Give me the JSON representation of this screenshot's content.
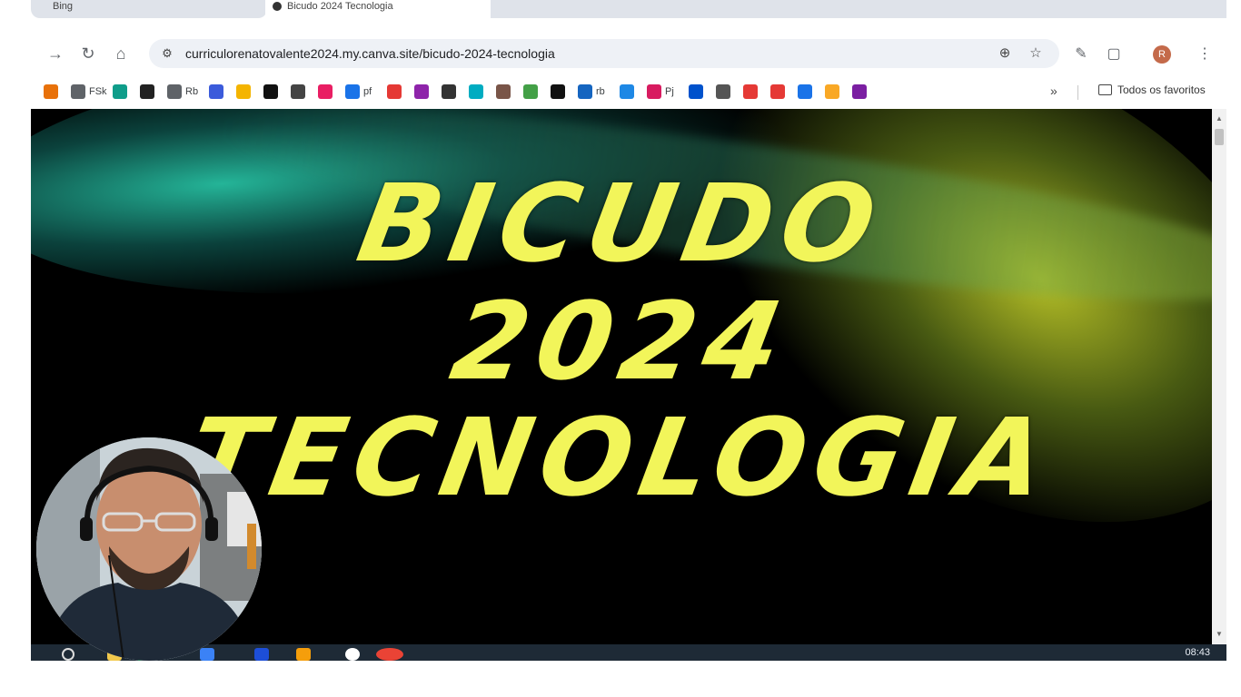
{
  "browser": {
    "tabs": [
      {
        "label": "Bing"
      },
      {
        "label": "Bicudo 2024 Tecnologia"
      }
    ],
    "url": "curriculorenatovalente2024.my.canva.site/bicudo-2024-tecnologia",
    "bookmarks": [
      {
        "label": "",
        "icon": "warning-triangle-icon",
        "color": "#e8710a"
      },
      {
        "label": "FSk",
        "icon": "globe-icon",
        "color": "#5f6368"
      },
      {
        "label": "",
        "icon": "globe-teal-icon",
        "color": "#0f9d8a"
      },
      {
        "label": "",
        "icon": "wikipedia-icon",
        "color": "#222222"
      },
      {
        "label": "Rb",
        "icon": "globe-icon",
        "color": "#5f6368"
      },
      {
        "label": "",
        "icon": "u-icon",
        "color": "#3b5bdb"
      },
      {
        "label": "",
        "icon": "yellow-square-icon",
        "color": "#f4b400"
      },
      {
        "label": "",
        "icon": "black-square-icon",
        "color": "#111111"
      },
      {
        "label": "",
        "icon": "grid-icon",
        "color": "#444444"
      },
      {
        "label": "",
        "icon": "colorful-square-icon",
        "color": "#e91e63"
      },
      {
        "label": "pf",
        "icon": "droplet-icon",
        "color": "#1a73e8"
      },
      {
        "label": "",
        "icon": "chart-icon",
        "color": "#e53935"
      },
      {
        "label": "",
        "icon": "circle-icon",
        "color": "#8e24aa"
      },
      {
        "label": "",
        "icon": "link-icon",
        "color": "#333333"
      },
      {
        "label": "",
        "icon": "q-icon",
        "color": "#00acc1"
      },
      {
        "label": "",
        "icon": "person-icon",
        "color": "#795548"
      },
      {
        "label": "",
        "icon": "palette-icon",
        "color": "#43a047"
      },
      {
        "label": "",
        "icon": "u-black-icon",
        "color": "#111111"
      },
      {
        "label": "rb",
        "icon": "r-icon",
        "color": "#1565c0"
      },
      {
        "label": "",
        "icon": "c-icon",
        "color": "#1e88e5"
      },
      {
        "label": "Pj",
        "icon": "stack-icon",
        "color": "#d81b60"
      },
      {
        "label": "",
        "icon": "trello-icon",
        "color": "#0052cc"
      },
      {
        "label": "",
        "icon": "openai-icon",
        "color": "#555555"
      },
      {
        "label": "",
        "icon": "y-icon",
        "color": "#e53935"
      },
      {
        "label": "",
        "icon": "grad-cap-icon",
        "color": "#e53935"
      },
      {
        "label": "",
        "icon": "sparkle-icon",
        "color": "#1a73e8"
      },
      {
        "label": "",
        "icon": "chevron-icon",
        "color": "#f9a825"
      },
      {
        "label": "",
        "icon": "u-breve-icon",
        "color": "#7b1fa2"
      }
    ],
    "bookmarks_more": "»",
    "all_bookmarks_label": "Todos os favoritos",
    "avatar_letter": "R"
  },
  "page": {
    "headline_line1": "BICUDO",
    "headline_line2": "2024",
    "headline_line3": "TECNOLOGIA"
  },
  "taskbar": {
    "clock": "08:43"
  }
}
